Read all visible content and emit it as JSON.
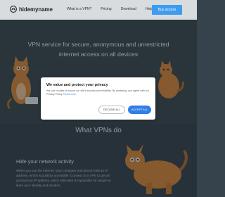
{
  "header": {
    "logo_text": "hidemyname",
    "nav": [
      "What is a VPN?",
      "Pricing",
      "Download",
      "Help"
    ],
    "cta_label": "Buy access"
  },
  "hero": {
    "title": "VPN service for secure, anonymous and unrestricted internet access on all devices"
  },
  "section": {
    "title": "What VPNs do",
    "heading": "Hide your network activity",
    "paragraph": "When you use the internet, your computer and phone hold an IP address, which is publicly accessible. Connect to a VPN to get an anonymous IP address, which will make it impossible for people to learn your identity and location."
  },
  "modal": {
    "title": "We value and protect your privacy",
    "text": "We use cookies to ensure our site's security and reliability. By accepting, you agree with our Privacy Policy.",
    "link": "Read more",
    "decline_label": "DECLINE ALL",
    "accept_label": "ACCEPT ALL"
  },
  "colors": {
    "accent": "#2f7fe6",
    "header_bg": "#d8dcdf",
    "page_bg": "#36434c",
    "cat_orange": "#d9893a"
  }
}
